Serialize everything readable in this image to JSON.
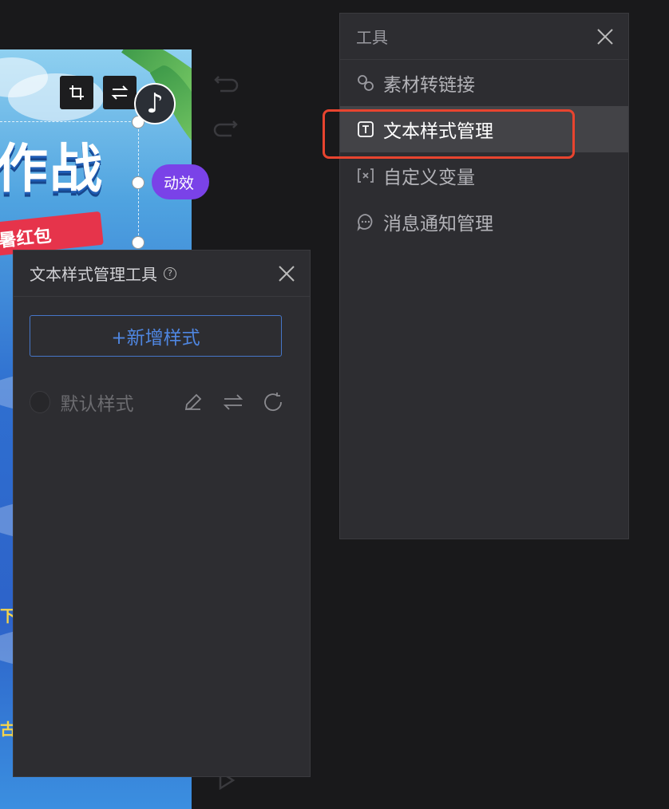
{
  "canvas": {
    "poster_title": "作战",
    "ribbon_text": "暑红包",
    "side_text_1": "下单",
    "side_text_2": "古",
    "effect_badge": "动效",
    "music_icon": "music-note-icon"
  },
  "tools_panel": {
    "title": "工具",
    "items": [
      {
        "label": "素材转链接",
        "icon": "link-icon"
      },
      {
        "label": "文本样式管理",
        "icon": "text-style-icon"
      },
      {
        "label": "自定义变量",
        "icon": "variable-icon"
      },
      {
        "label": "消息通知管理",
        "icon": "message-icon"
      }
    ]
  },
  "text_style_panel": {
    "title": "文本样式管理工具",
    "add_button": "+新增样式",
    "styles": [
      {
        "name": "默认样式"
      }
    ]
  },
  "colors": {
    "accent": "#4f86e0",
    "highlight": "#e8442f",
    "effect_badge": "#7a42e8",
    "panel_bg": "#2d2d31",
    "app_bg": "#19191b"
  }
}
